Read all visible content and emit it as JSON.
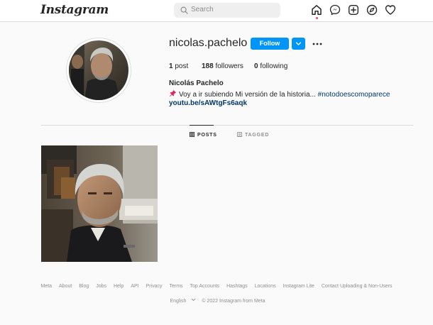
{
  "header": {
    "logo": "Instagram",
    "search_placeholder": "Search",
    "nav_icons": [
      "home-icon",
      "messenger-icon",
      "new-post-icon",
      "explore-icon",
      "activity-heart-icon"
    ]
  },
  "profile": {
    "username": "nicolas.pachelo",
    "follow_label": "Follow",
    "stats": [
      {
        "count": "1",
        "label": "post"
      },
      {
        "count": "188",
        "label": "followers"
      },
      {
        "count": "0",
        "label": "following"
      }
    ],
    "full_name": "Nicolás Pachelo",
    "bio_text": "Voy a ir subiendo Mi versión de la historia...",
    "bio_hashtag": "#notodoescomoparece",
    "bio_emoji": "pushpin-icon",
    "link": "youtu.be/sAWtgFs6aqk"
  },
  "tabs": [
    {
      "label": "POSTS",
      "icon": "grid-icon",
      "active": true
    },
    {
      "label": "TAGGED",
      "icon": "tagged-icon",
      "active": false
    }
  ],
  "footer": {
    "links": [
      "Meta",
      "About",
      "Blog",
      "Jobs",
      "Help",
      "API",
      "Privacy",
      "Terms",
      "Top Accounts",
      "Hashtags",
      "Locations",
      "Instagram Lite",
      "Contact Uploading & Non-Users"
    ],
    "language": "English",
    "copyright": "© 2022 Instagram from Meta"
  },
  "colors": {
    "accent": "#0095f6",
    "link": "#00376b",
    "notification": "#ed4956",
    "muted": "#8e8e8e"
  }
}
